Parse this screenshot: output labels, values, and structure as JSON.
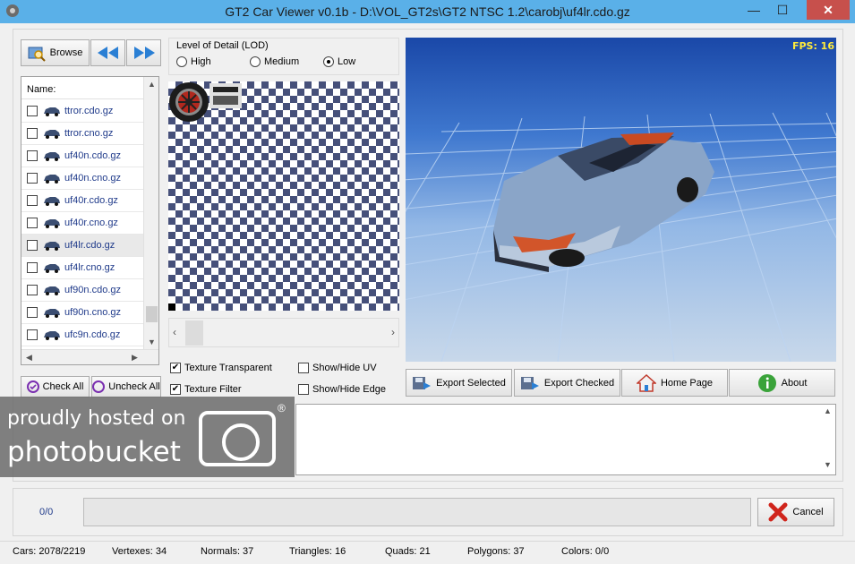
{
  "window": {
    "title": "GT2 Car Viewer v0.1b - D:\\VOL_GT2s\\GT2 NTSC 1.2\\carobj\\uf4lr.cdo.gz",
    "minimize_glyph": "—",
    "maximize_glyph": "☐",
    "close_glyph": "✕"
  },
  "toolbar": {
    "browse_label": "Browse",
    "prev_icon": "double-left-arrow-icon",
    "next_icon": "double-right-arrow-icon"
  },
  "file_list": {
    "header": "Name:",
    "items": [
      {
        "name": "ttror.cdo.gz",
        "checked": false
      },
      {
        "name": "ttror.cno.gz",
        "checked": false
      },
      {
        "name": "uf40n.cdo.gz",
        "checked": false
      },
      {
        "name": "uf40n.cno.gz",
        "checked": false
      },
      {
        "name": "uf40r.cdo.gz",
        "checked": false
      },
      {
        "name": "uf40r.cno.gz",
        "checked": false
      },
      {
        "name": "uf4lr.cdo.gz",
        "checked": false,
        "selected": true
      },
      {
        "name": "uf4lr.cno.gz",
        "checked": false
      },
      {
        "name": "uf90n.cdo.gz",
        "checked": false
      },
      {
        "name": "uf90n.cno.gz",
        "checked": false
      },
      {
        "name": "ufc9n.cdo.gz",
        "checked": false
      }
    ]
  },
  "list_buttons": {
    "check_all": "Check All",
    "uncheck_all": "Uncheck All"
  },
  "lod": {
    "label": "Level of Detail (LOD)",
    "options": [
      "High",
      "Medium",
      "Low"
    ],
    "selected": "Low"
  },
  "texture_options": {
    "transparent": {
      "label": "Texture Transparent",
      "checked": true
    },
    "filter": {
      "label": "Texture Filter",
      "checked": true
    },
    "show_uv": {
      "label": "Show/Hide UV",
      "checked": false
    },
    "show_edge": {
      "label": "Show/Hide Edge",
      "checked": false
    }
  },
  "viewport": {
    "fps": "FPS: 16"
  },
  "actions": {
    "export_selected": "Export Selected",
    "export_checked": "Export Checked",
    "home_page": "Home Page",
    "about": "About"
  },
  "watermark": {
    "line1": "proudly hosted on",
    "line2": "photobucket",
    "reg": "®"
  },
  "progress": {
    "count": "0/0",
    "fraction": 0,
    "cancel_label": "Cancel"
  },
  "status": {
    "cars": "Cars: 2078/2219",
    "vertexes": "Vertexes: 34",
    "normals": "Normals: 37",
    "triangles": "Triangles: 16",
    "quads": "Quads: 21",
    "polygons": "Polygons: 37",
    "colors": "Colors: 0/0"
  },
  "colors": {
    "titlebar": "#5ab0e8",
    "close": "#c7504c",
    "fps": "#ffeb3b",
    "link": "#1f3a8a"
  }
}
